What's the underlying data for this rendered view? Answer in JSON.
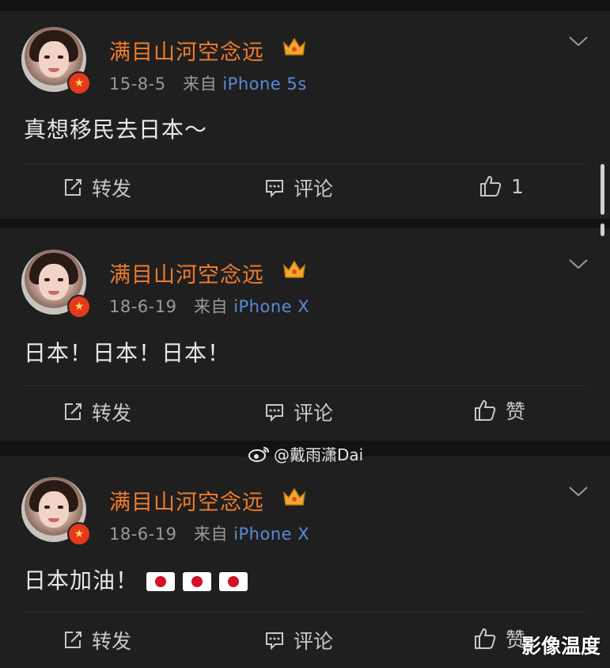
{
  "posts": [
    {
      "username": "满目山河空念远",
      "date": "15-8-5",
      "from_label": "来自",
      "device": "iPhone 5s",
      "text": "真想移民去日本～",
      "repost_label": "转发",
      "comment_label": "评论",
      "like_label": "1"
    },
    {
      "username": "满目山河空念远",
      "date": "18-6-19",
      "from_label": "来自",
      "device": "iPhone X",
      "text": "日本！日本！日本！",
      "repost_label": "转发",
      "comment_label": "评论",
      "like_label": "赞"
    },
    {
      "username": "满目山河空念远",
      "date": "18-6-19",
      "from_label": "来自",
      "device": "iPhone X",
      "text": "日本加油！",
      "flags": [
        "japan-flag",
        "japan-flag",
        "japan-flag"
      ],
      "repost_label": "转发",
      "comment_label": "评论",
      "like_label": "赞"
    }
  ],
  "watermarks": {
    "weibo_handle": "@戴雨潇Dai",
    "corner_text": "影像温度"
  },
  "colors": {
    "background": "#121212",
    "card": "#1f1f1f",
    "username": "#ef7d2c",
    "device_link": "#5a8bd6",
    "meta": "#9a9a9a",
    "text": "#e8e8e8"
  }
}
